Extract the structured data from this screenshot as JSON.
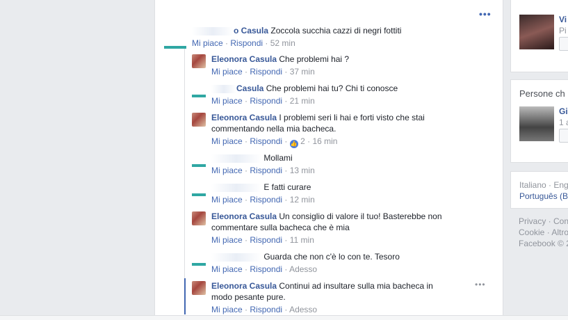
{
  "feed": {
    "more": "•••",
    "comments": [
      {
        "name": "",
        "name_fragment": "o Casula",
        "text": "Zoccola succhia cazzi di negri fottiti",
        "like": "Mi piace",
        "reply": "Rispondi",
        "time": "52 min"
      },
      {
        "name": "Eleonora Casula",
        "text": "Che problemi hai ?",
        "like": "Mi piace",
        "reply": "Rispondi",
        "time": "37 min"
      },
      {
        "name": "",
        "name_fragment": "Casula",
        "text": "Che problemi hai tu? Chi ti conosce",
        "like": "Mi piace",
        "reply": "Rispondi",
        "time": "21 min"
      },
      {
        "name": "Eleonora Casula",
        "text": "I problemi seri li hai e forti visto che stai commentando nella mia bacheca.",
        "like": "Mi piace",
        "reply": "Rispondi",
        "reactions": "2",
        "time": "16 min"
      },
      {
        "name": "",
        "text": "Mollami",
        "like": "Mi piace",
        "reply": "Rispondi",
        "time": "13 min"
      },
      {
        "name": "",
        "text": "E fatti curare",
        "like": "Mi piace",
        "reply": "Rispondi",
        "time": "12 min"
      },
      {
        "name": "Eleonora Casula",
        "text": "Un consiglio di valore il tuo! Basterebbe non commentare sulla bacheca che è mia",
        "like": "Mi piace",
        "reply": "Rispondi",
        "time": "11 min"
      },
      {
        "name": "",
        "text": "Guarda che non c'è lo con te. Tesoro",
        "like": "Mi piace",
        "reply": "Rispondi",
        "time": "Adesso"
      },
      {
        "name": "Eleonora Casula",
        "text": "Continui ad insultare sulla mia bacheca in modo pesante pure.",
        "like": "Mi piace",
        "reply": "Rispondi",
        "time": "Adesso"
      }
    ],
    "options": "•••"
  },
  "right": {
    "profile1": {
      "name": "Vi",
      "sub": "Pi"
    },
    "people_title": "Persone ch",
    "profile2": {
      "name": "Gi",
      "sub": "1 a"
    },
    "languages": [
      "Italiano · Eng",
      "Português (B"
    ],
    "footer": [
      "Privacy · Con",
      "Cookie · Altro",
      "Facebook © 2"
    ]
  }
}
